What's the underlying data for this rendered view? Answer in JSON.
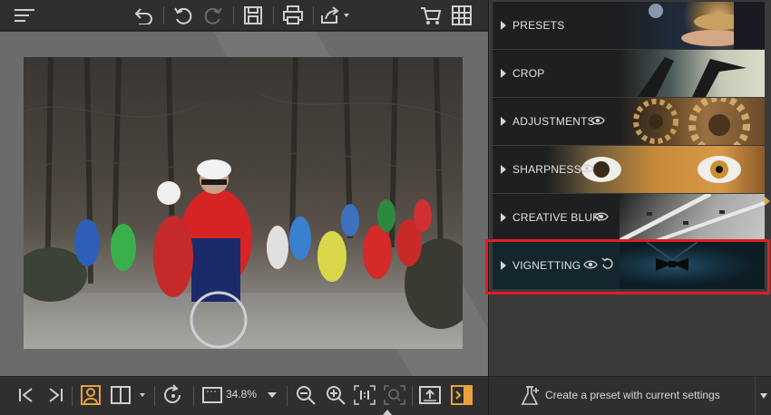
{
  "toolbar": {
    "icons": [
      "menu-icon",
      "undo-history-icon",
      "undo-icon",
      "redo-icon",
      "save-icon",
      "print-icon",
      "share-icon",
      "cart-icon",
      "grid-icon"
    ]
  },
  "bottombar": {
    "zoom": "34.8%"
  },
  "panel": {
    "sections": [
      {
        "label": "PRESETS",
        "eye": false,
        "reset": false
      },
      {
        "label": "CROP",
        "eye": false,
        "reset": false
      },
      {
        "label": "ADJUSTMENTS",
        "eye": true,
        "reset": false
      },
      {
        "label": "SHARPNESS",
        "eye": true,
        "reset": false
      },
      {
        "label": "CREATIVE BLUR",
        "eye": true,
        "reset": false
      },
      {
        "label": "VIGNETTING",
        "eye": true,
        "reset": true
      }
    ],
    "create_preset": "Create a preset with current settings"
  },
  "colors": {
    "accent": "#e8a23c",
    "highlight": "#e01f26"
  }
}
